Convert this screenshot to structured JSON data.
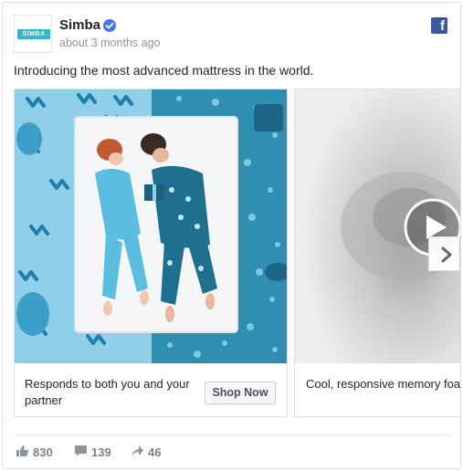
{
  "post": {
    "page_name": "Simba",
    "avatar_logo": "SIMBA",
    "timestamp": "about 3 months ago",
    "text": "Introducing the most advanced mattress in the world.",
    "verified_icon": "verified-badge-icon",
    "network_icon": "facebook-icon"
  },
  "carousel": {
    "cards": [
      {
        "title": "Responds to both you and your partner",
        "cta": "Shop Now",
        "image": "couple-on-mattress-photo"
      },
      {
        "title": "Cool, responsive memory foam",
        "image": "memory-foam-video-thumbnail"
      }
    ]
  },
  "stats": {
    "likes": "830",
    "comments": "139",
    "shares": "46"
  },
  "colors": {
    "accent": "#4267b2",
    "facebook": "#3b5998",
    "simba_teal": "#35b6c9",
    "card_blue_light": "#8fd0e8",
    "card_blue_dark": "#2f8fb1"
  }
}
